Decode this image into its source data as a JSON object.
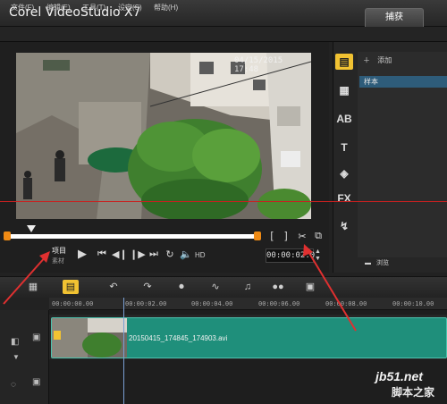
{
  "app": {
    "title": "Corel VideoStudio X7",
    "capture_tab": "捕获"
  },
  "menu": [
    "文件(F)",
    "编辑(E)",
    "工具(T)",
    "设定(S)",
    "帮助(H)"
  ],
  "player": {
    "timestamp": "04/15/2015 17:48",
    "mode_project": "项目",
    "mode_clip": "素材",
    "hd": "HD",
    "timecode": "00:00:02.0"
  },
  "library": {
    "add_label": "添加",
    "selected_item": "样本",
    "browse_label": "浏览"
  },
  "timeline": {
    "ruler_ticks": [
      "00:00:00.00",
      "00:00:02.00",
      "00:00:04.00",
      "00:00:06.00",
      "00:00:08.00",
      "00:00:10.00"
    ],
    "clip_name": "20150415_174845_174903.avi"
  },
  "watermark": {
    "site": "jb51.net",
    "name": "脚本之家"
  },
  "colors": {
    "accent": "#f1c232",
    "clip": "#1f8f7b",
    "trim": "#ef8a14",
    "annotation": "#e03030"
  }
}
